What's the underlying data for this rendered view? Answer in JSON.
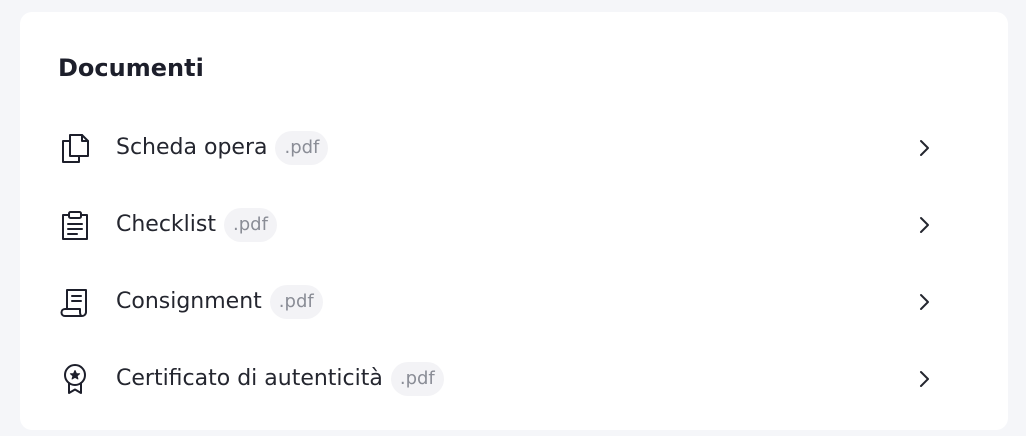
{
  "card": {
    "title": "Documenti"
  },
  "documents": [
    {
      "name": "Scheda opera",
      "extension": ".pdf",
      "icon": "copy-document-icon"
    },
    {
      "name": "Checklist",
      "extension": ".pdf",
      "icon": "clipboard-list-icon"
    },
    {
      "name": "Consignment",
      "extension": ".pdf",
      "icon": "receipt-scroll-icon"
    },
    {
      "name": "Certificato di autenticità",
      "extension": ".pdf",
      "icon": "award-badge-icon"
    }
  ],
  "colors": {
    "background": "#f5f6f9",
    "card": "#ffffff",
    "text": "#24262f",
    "pill_background": "#f3f3f6",
    "pill_text": "#8a8d96"
  }
}
